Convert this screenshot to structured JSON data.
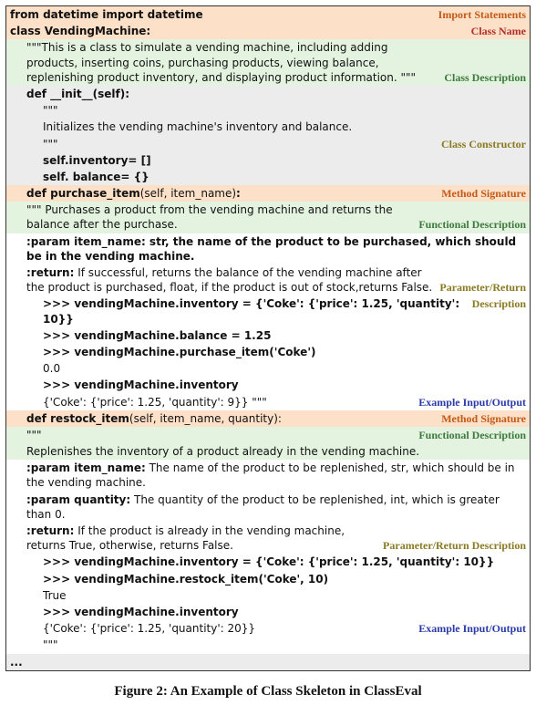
{
  "tags": {
    "import_statements": "Import Statements",
    "class_name": "Class Name",
    "class_description": "Class Description",
    "class_constructor": "Class Constructor",
    "method_signature1": "Method Signature",
    "functional_description1": "Functional Description",
    "param_return1": "Parameter/Return",
    "description_word": "Description",
    "example_io1": "Example Input/Output",
    "method_signature2": "Method Signature",
    "functional_description2": "Functional Description",
    "param_return2": "Parameter/Return Description",
    "example_io2": "Example Input/Output"
  },
  "code": {
    "import_line": "from datetime import datetime",
    "class_def_pre": "class ",
    "class_def_name": "VendingMachine:",
    "class_doc": "\"\"\"This is a class to simulate a vending machine, including adding products, inserting coins, purchasing products, viewing balance, replenishing product inventory, and displaying product information. \"\"\"",
    "init_sig": "def __init__(self):",
    "init_doc_open": "\"\"\"",
    "init_doc_line": "Initializes the vending machine's inventory and balance.",
    "init_doc_close": "\"\"\"",
    "init_body1": "self.inventory= []",
    "init_body2": "self. balance= {}",
    "m1_sig_pre": "def ",
    "m1_sig_name": "purchase_item",
    "m1_sig_rest1": "(self, item_name)",
    "m1_sig_rest2": ":",
    "m1_doc": "\"\"\" Purchases a product from the vending machine and returns the balance after the purchase.",
    "m1_param": ":param item_name: str, the name of the product to be purchased, which should be in the vending machine.",
    "m1_return_label": ":return:",
    "m1_return_rest": " If successful, returns the balance of the vending machine after the product is purchased, float, if the product is out of stock,returns False.",
    "m1_ex1": ">>> vendingMachine.inventory = {'Coke': {'price': 1.25, 'quantity': 10}}",
    "m1_ex2": ">>> vendingMachine.balance = 1.25",
    "m1_ex3": ">>> vendingMachine.purchase_item('Coke')",
    "m1_ex4": "0.0",
    "m1_ex5": ">>> vendingMachine.inventory",
    "m1_ex6": "{'Coke': {'price': 1.25, 'quantity': 9}} \"\"\"",
    "m2_sig_pre": "def ",
    "m2_sig_name": "restock_item",
    "m2_sig_rest": "(self, item_name, quantity):",
    "m2_doc_open": "\"\"\"",
    "m2_doc": "Replenishes the inventory of a product already in the vending machine.",
    "m2_param1_label": ":param item_name:",
    "m2_param1_rest": " The name of the product to be replenished, str, which should be in the vending machine.",
    "m2_param2_label": ":param quantity:",
    "m2_param2_rest": " The quantity of the product to be replenished, int, which is greater than 0.",
    "m2_return_label": ":return:",
    "m2_return_rest": " If the product is already in the vending machine, returns True, otherwise, returns False.",
    "m2_ex1": ">>> vendingMachine.inventory = {'Coke': {'price': 1.25, 'quantity': 10}}",
    "m2_ex2": ">>> vendingMachine.restock_item('Coke', 10)",
    "m2_ex3": "True",
    "m2_ex4": ">>> vendingMachine.inventory",
    "m2_ex5": "{'Coke': {'price': 1.25, 'quantity': 20}}",
    "m2_doc_close": "\"\"\"",
    "ellipsis": "..."
  },
  "caption": "Figure 2: An Example of Class Skeleton in ClassEval"
}
